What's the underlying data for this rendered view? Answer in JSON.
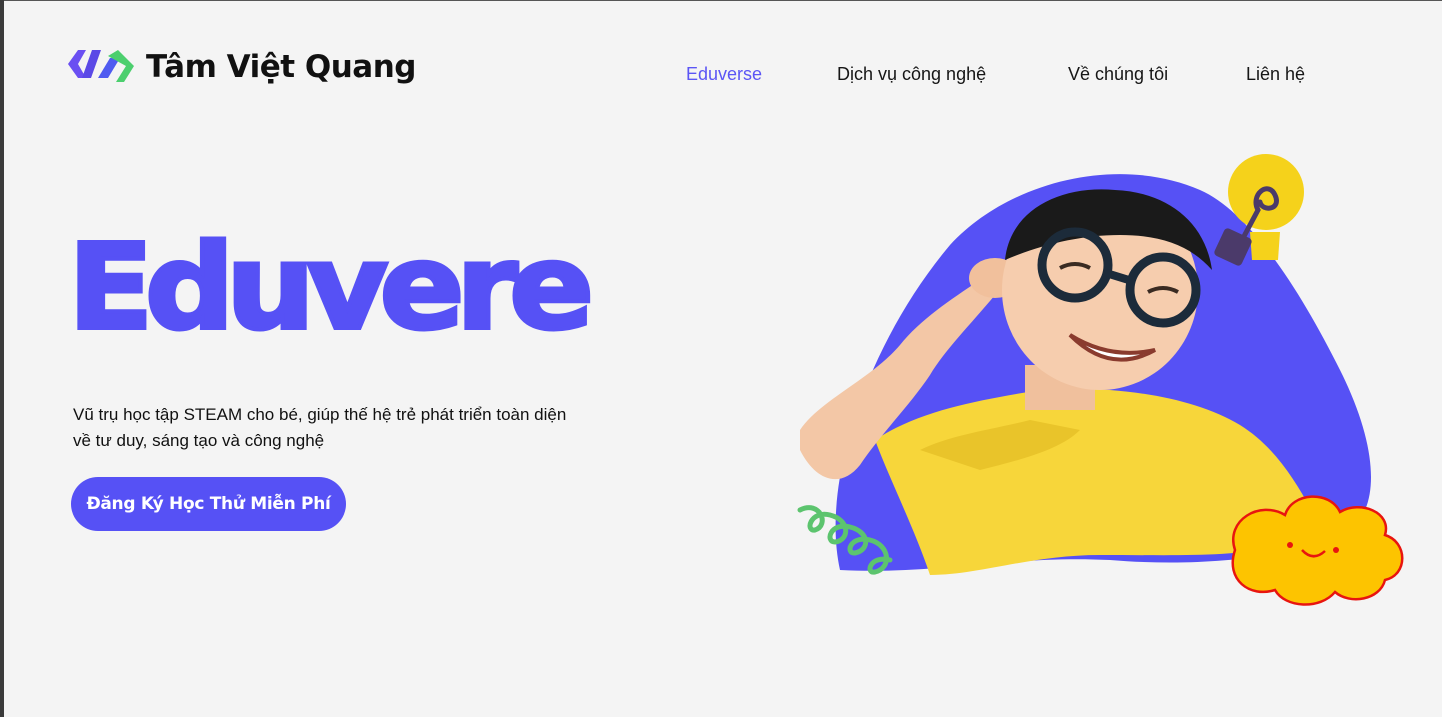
{
  "brand": {
    "name": "Tâm Việt Quang",
    "colors": {
      "primary": "#5651f5",
      "logo_purple": "#6a4ff2",
      "logo_green": "#4ccf6e"
    }
  },
  "nav": {
    "items": [
      {
        "label": "Eduverse",
        "active": true
      },
      {
        "label": "Dịch vụ công nghệ",
        "active": false
      },
      {
        "label": "Về chúng tôi",
        "active": false
      },
      {
        "label": "Liên hệ",
        "active": false
      }
    ]
  },
  "hero": {
    "title": "Eduvere",
    "description_line1": "Vũ trụ học tập STEAM cho bé, giúp thế hệ trẻ phát triển toàn diện",
    "description_line2": "về tư duy, sáng tạo và công nghệ",
    "cta_label": "Đăng Ký Học Thử Miễn Phí"
  },
  "illustration": {
    "elements": [
      "lightbulb-icon",
      "spring-squiggle-icon",
      "smiling-cloud-icon"
    ]
  }
}
